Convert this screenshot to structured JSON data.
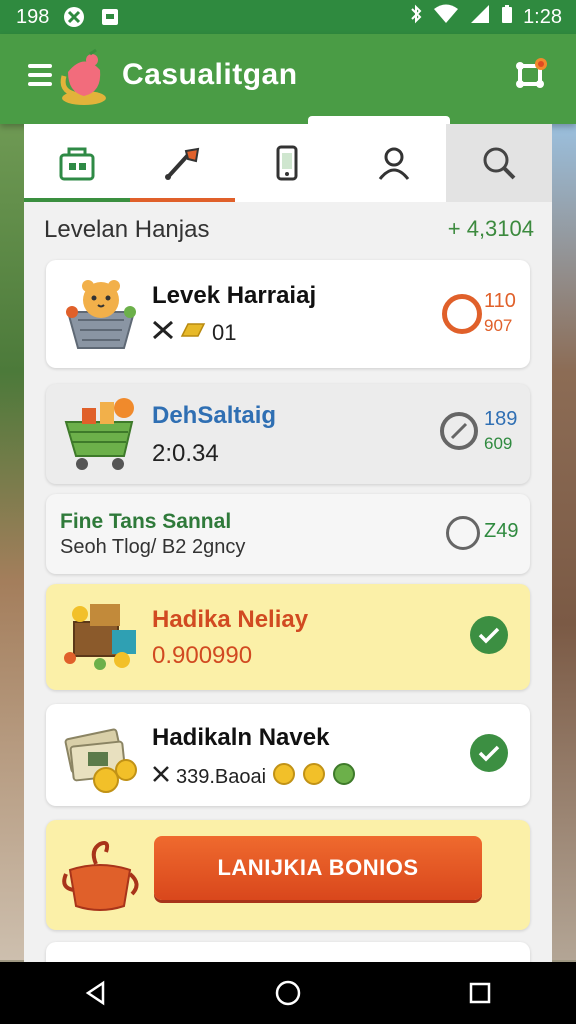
{
  "status_bar": {
    "time_left": "198",
    "time_right": "1:28",
    "icons": [
      "no-disturb-icon",
      "sim-icon",
      "bluetooth-icon",
      "wifi-icon",
      "signal-icon",
      "battery-icon"
    ]
  },
  "app_bar": {
    "title": "Casualitgan",
    "icons": [
      "menu-icon",
      "app-logo-icon",
      "settings-network-icon"
    ]
  },
  "tabs": [
    {
      "icon": "store-icon",
      "state": "selected-green"
    },
    {
      "icon": "paint-brush-icon",
      "state": "selected-orange"
    },
    {
      "icon": "phone-icon",
      "state": "normal"
    },
    {
      "icon": "profile-icon",
      "state": "normal"
    },
    {
      "icon": "search-icon",
      "state": "highlighted"
    }
  ],
  "section": {
    "title": "Levelan Hanjas",
    "value": "+ 4,3104"
  },
  "cards": [
    {
      "title": "Levek Harraiaj",
      "subtitle": "01",
      "val_a": "110",
      "val_b": "907",
      "status": "ring-orange",
      "color": "#e0602a"
    },
    {
      "title": "DehSaltaig",
      "subtitle": "2:0.34",
      "val_a": "189",
      "val_b": "609",
      "status": "ring-gray",
      "color": "#2f6fb3"
    },
    {
      "title": "Fine Tans Sannal",
      "subtitle": "Seoh Tlog/ B2 2gncy",
      "val_a": "Z49",
      "status": "ring-gray"
    },
    {
      "title": "Hadika Neliay",
      "subtitle": "0.900990",
      "status": "check"
    },
    {
      "title": "Hadikaln Navek",
      "subtitle": "339.Baoai"
    }
  ],
  "cta": {
    "label": "LANIJKIA BONIOS"
  },
  "colors": {
    "primary": "#4a9c45",
    "status_bar": "#2f8a3f",
    "accent": "#e0602a",
    "check": "#3c8f42",
    "highlight_card": "#fbf0a8"
  },
  "nav": [
    "back-icon",
    "home-icon",
    "recents-icon"
  ]
}
